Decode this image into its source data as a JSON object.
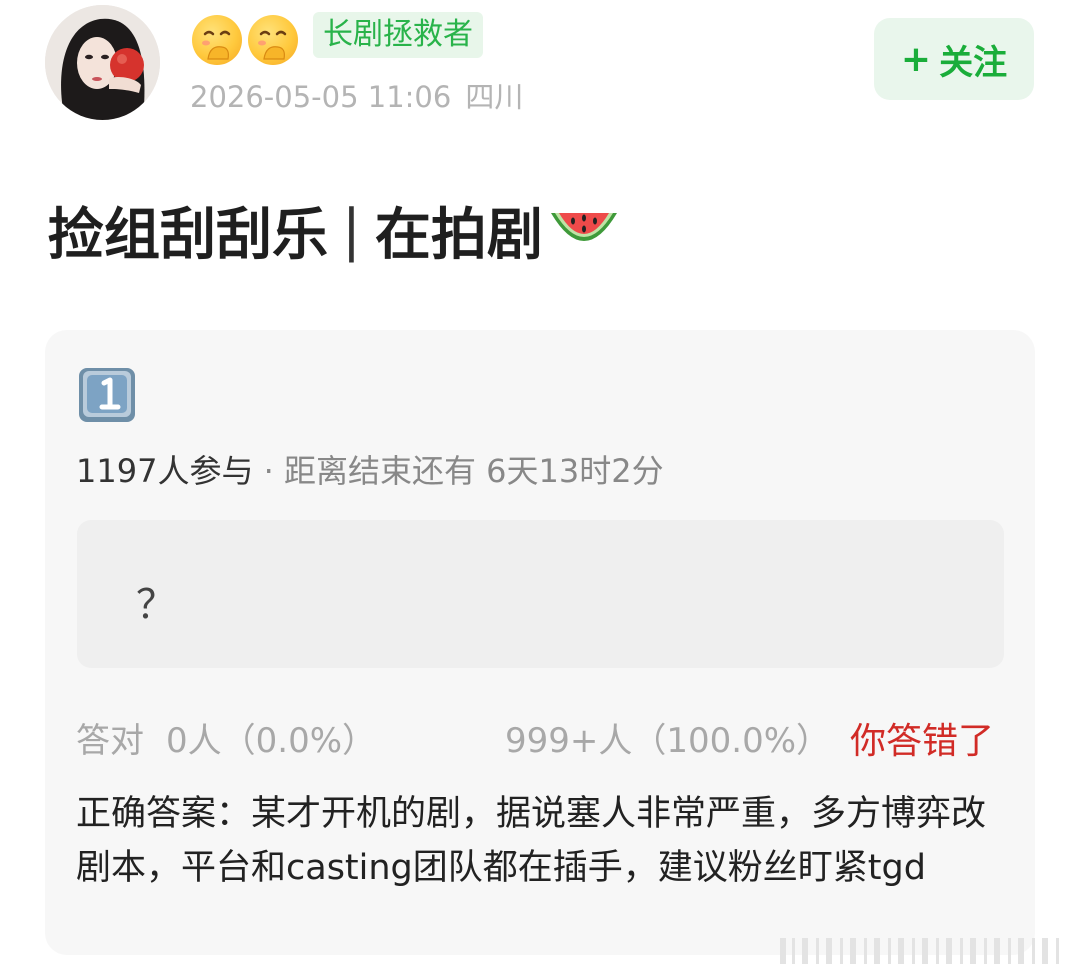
{
  "post": {
    "avatar_icon": "user-avatar",
    "emoji_icons": [
      "hand-over-mouth-face",
      "hand-over-mouth-face"
    ],
    "badge": "长剧拯救者",
    "timestamp": "2026-05-05 11:06",
    "location": "四川",
    "follow_plus": "+",
    "follow_label": "关注",
    "title_part1": "捡组刮刮乐",
    "title_separator": "|",
    "title_part2": "在拍剧",
    "title_emoji_icon": "watermelon-icon"
  },
  "quiz": {
    "number_icon": "keycap-1",
    "participants": "1197人参与",
    "separator": " · ",
    "time_left": "距离结束还有 6天13时2分",
    "option_text": "？",
    "correct_label": "答对",
    "correct_value": "0人（0.0%）",
    "other_value": "999+人（100.0%）",
    "wrong_label": "你答错了",
    "answer_text": "正确答案：某才开机的剧，据说塞人非常严重，多方博弈改剧本，平台和casting团队都在插手，建议粉丝盯紧tgd"
  },
  "colors": {
    "accent_green": "#1aad3a",
    "badge_bg": "#e8f6ea",
    "wrong_red": "#d12b26"
  }
}
